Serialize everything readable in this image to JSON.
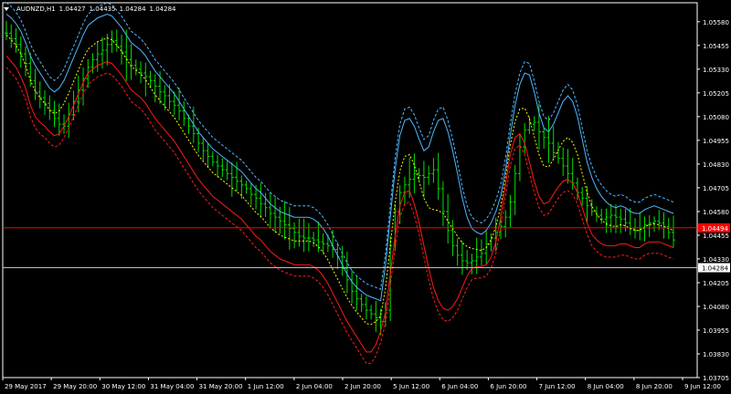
{
  "symbol": "AUDNZD,H1",
  "ohlc": [
    "1.04427",
    "1.04435",
    "1.04284",
    "1.04284"
  ],
  "colors": {
    "background": "#000000",
    "candles": "#00e000",
    "upper_band": "#4fb8ff",
    "lower_band": "#ff1a1a",
    "mid_line": "#ffff00",
    "price_line_red": "#ff0000",
    "price_line_gray": "#c0c0c0",
    "axis": "#ffffff"
  },
  "chart_data": {
    "type": "line",
    "y_range": [
      1.03705,
      1.0568
    ],
    "y_ticks": [
      "1.05580",
      "1.05455",
      "1.05330",
      "1.05205",
      "1.05080",
      "1.04955",
      "1.04830",
      "1.04705",
      "1.04580",
      "1.04455",
      "1.04330",
      "1.04205",
      "1.04080",
      "1.03955",
      "1.03830",
      "1.03705"
    ],
    "x_ticks": [
      "29 May 2017",
      "29 May 20:00",
      "30 May 12:00",
      "31 May 04:00",
      "31 May 20:00",
      "1 Jun 12:00",
      "2 Jun 04:00",
      "2 Jun 20:00",
      "5 Jun 12:00",
      "6 Jun 04:00",
      "6 Jun 20:00",
      "7 Jun 12:00",
      "8 Jun 04:00",
      "8 Jun 20:00",
      "9 Jun 12:00"
    ],
    "price_labels": [
      {
        "text": "1.04494",
        "value": 1.04494,
        "style": "red"
      },
      {
        "text": "1.04284",
        "value": 1.04284,
        "style": "white"
      }
    ],
    "price_series": [
      1.0552,
      1.0549,
      1.0546,
      1.0541,
      1.0536,
      1.0527,
      1.0521,
      1.0518,
      1.0515,
      1.0511,
      1.0507,
      1.0504,
      1.0503,
      1.0509,
      1.0516,
      1.0522,
      1.0528,
      1.0534,
      1.0538,
      1.0541,
      1.0543,
      1.0546,
      1.0548,
      1.0545,
      1.0542,
      1.0538,
      1.0535,
      1.0533,
      1.0531,
      1.0529,
      1.0527,
      1.0524,
      1.0521,
      1.0519,
      1.0516,
      1.0514,
      1.0511,
      1.0507,
      1.0503,
      1.0499,
      1.0494,
      1.049,
      1.0487,
      1.0484,
      1.0482,
      1.048,
      1.0478,
      1.0476,
      1.0474,
      1.0472,
      1.047,
      1.0467,
      1.0465,
      1.0462,
      1.046,
      1.0457,
      1.0455,
      1.0453,
      1.0451,
      1.0449,
      1.0447,
      1.0445,
      1.0444,
      1.0444,
      1.0443,
      1.0442,
      1.0441,
      1.044,
      1.0438,
      1.0434,
      1.0428,
      1.0422,
      1.0416,
      1.0412,
      1.0409,
      1.0406,
      1.0404,
      1.0402,
      1.04,
      1.0406,
      1.044,
      1.0458,
      1.0468,
      1.0472,
      1.0475,
      1.0478,
      1.0477,
      1.0476,
      1.0478,
      1.048,
      1.047,
      1.0458,
      1.0448,
      1.044,
      1.0435,
      1.0432,
      1.0431,
      1.0432,
      1.0434,
      1.0436,
      1.0441,
      1.0444,
      1.0447,
      1.045,
      1.0455,
      1.0463,
      1.0478,
      1.0492,
      1.0501,
      1.0504,
      1.0505,
      1.05,
      1.0497,
      1.0494,
      1.0489,
      1.0486,
      1.0482,
      1.0478,
      1.0473,
      1.0468,
      1.0465,
      1.0461,
      1.0458,
      1.0456,
      1.0454,
      1.0455,
      1.0456,
      1.0455,
      1.0454,
      1.0452,
      1.0449,
      1.0448,
      1.0449,
      1.0451,
      1.0452,
      1.0453,
      1.0452,
      1.045,
      1.0447,
      1.0443
    ],
    "upper_band": [
      1.0562,
      1.056,
      1.0557,
      1.0553,
      1.0547,
      1.054,
      1.0535,
      1.0531,
      1.0527,
      1.0523,
      1.0521,
      1.0523,
      1.0527,
      1.0533,
      1.0539,
      1.0545,
      1.0551,
      1.0556,
      1.0558,
      1.056,
      1.0561,
      1.0562,
      1.0561,
      1.0558,
      1.0555,
      1.0551,
      1.0547,
      1.0545,
      1.0543,
      1.054,
      1.0536,
      1.0532,
      1.0529,
      1.0526,
      1.0523,
      1.052,
      1.0516,
      1.0512,
      1.0508,
      1.0504,
      1.05,
      1.0497,
      1.0494,
      1.0491,
      1.0489,
      1.0487,
      1.0485,
      1.0483,
      1.0481,
      1.0479,
      1.0476,
      1.0473,
      1.047,
      1.0468,
      1.0465,
      1.0462,
      1.046,
      1.0458,
      1.0457,
      1.0456,
      1.0455,
      1.0455,
      1.0455,
      1.0455,
      1.0454,
      1.0452,
      1.0449,
      1.0445,
      1.044,
      1.0435,
      1.043,
      1.0425,
      1.0421,
      1.0418,
      1.0416,
      1.0414,
      1.0413,
      1.0412,
      1.0411,
      1.043,
      1.0455,
      1.048,
      1.0498,
      1.0506,
      1.0507,
      1.0503,
      1.0496,
      1.049,
      1.0492,
      1.05,
      1.0506,
      1.0507,
      1.05,
      1.049,
      1.0478,
      1.0465,
      1.0455,
      1.0449,
      1.0447,
      1.0446,
      1.0448,
      1.0452,
      1.0458,
      1.0466,
      1.048,
      1.0498,
      1.0514,
      1.0525,
      1.0531,
      1.053,
      1.0521,
      1.051,
      1.0502,
      1.05,
      1.0504,
      1.051,
      1.0516,
      1.0519,
      1.0516,
      1.0508,
      1.0496,
      1.0484,
      1.0476,
      1.047,
      1.0466,
      1.0463,
      1.0461,
      1.046,
      1.0461,
      1.046,
      1.0458,
      1.0457,
      1.0457,
      1.0459,
      1.046,
      1.0461,
      1.046,
      1.0459,
      1.0458,
      1.0457
    ],
    "lower_band": [
      1.054,
      1.0537,
      1.0534,
      1.0529,
      1.0523,
      1.0514,
      1.0508,
      1.0505,
      1.0503,
      1.05,
      1.0498,
      1.0499,
      1.0503,
      1.0508,
      1.0514,
      1.052,
      1.0526,
      1.0531,
      1.0533,
      1.0535,
      1.0536,
      1.0537,
      1.0536,
      1.0533,
      1.053,
      1.0526,
      1.0522,
      1.052,
      1.0518,
      1.0515,
      1.0511,
      1.0507,
      1.0504,
      1.0501,
      1.0498,
      1.0495,
      1.0491,
      1.0487,
      1.0483,
      1.0479,
      1.0475,
      1.0472,
      1.0469,
      1.0466,
      1.0464,
      1.0462,
      1.046,
      1.0458,
      1.0456,
      1.0454,
      1.0451,
      1.0448,
      1.0445,
      1.0443,
      1.044,
      1.0437,
      1.0435,
      1.0433,
      1.0432,
      1.0431,
      1.043,
      1.043,
      1.043,
      1.043,
      1.0429,
      1.0427,
      1.0424,
      1.042,
      1.0415,
      1.041,
      1.0405,
      1.04,
      1.0396,
      1.0392,
      1.0388,
      1.0384,
      1.0384,
      1.0388,
      1.0395,
      1.0405,
      1.0425,
      1.0445,
      1.0461,
      1.0468,
      1.0469,
      1.0462,
      1.0452,
      1.044,
      1.0428,
      1.0418,
      1.0411,
      1.0407,
      1.0406,
      1.0408,
      1.0412,
      1.0418,
      1.0424,
      1.0428,
      1.0429,
      1.0429,
      1.043,
      1.0434,
      1.0442,
      1.0455,
      1.0472,
      1.0488,
      1.0497,
      1.0499,
      1.0494,
      1.0484,
      1.0474,
      1.0466,
      1.0462,
      1.0463,
      1.0467,
      1.0471,
      1.0474,
      1.0475,
      1.0473,
      1.0468,
      1.046,
      1.0452,
      1.0446,
      1.0443,
      1.0441,
      1.044,
      1.044,
      1.044,
      1.0441,
      1.0441,
      1.044,
      1.0439,
      1.0439,
      1.0441,
      1.0442,
      1.0442,
      1.0442,
      1.0441,
      1.044,
      1.0439
    ]
  }
}
